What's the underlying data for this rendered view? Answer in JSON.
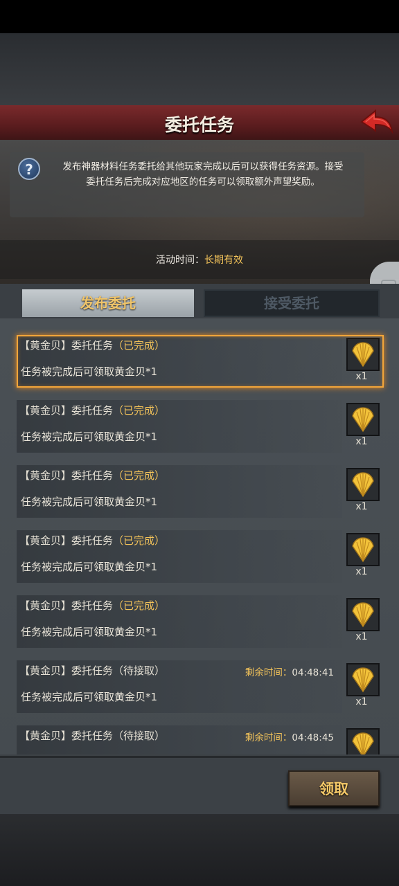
{
  "header": {
    "title": "委托任务"
  },
  "info": {
    "line1": "发布神器材料任务委托给其他玩家完成以后可以获得任务资源。接受",
    "line2": "委托任务后完成对应地区的任务可以领取额外声望奖励。",
    "activity_label": "活动时间：",
    "activity_value": "长期有效"
  },
  "tabs": [
    {
      "label": "发布委托",
      "active": true
    },
    {
      "label": "接受委托",
      "active": false
    }
  ],
  "tasks": [
    {
      "prefix": "【黄金贝】委托任务",
      "status": "（已完成）",
      "desc": "任务被完成后可领取黄金贝*1",
      "reward_icon": "golden-shell-icon",
      "count": "x1",
      "timer_label": "",
      "timer_value": ""
    },
    {
      "prefix": "【黄金贝】委托任务",
      "status": "（已完成）",
      "desc": "任务被完成后可领取黄金贝*1",
      "reward_icon": "golden-shell-icon",
      "count": "x1",
      "timer_label": "",
      "timer_value": ""
    },
    {
      "prefix": "【黄金贝】委托任务",
      "status": "（已完成）",
      "desc": "任务被完成后可领取黄金贝*1",
      "reward_icon": "golden-shell-icon",
      "count": "x1",
      "timer_label": "",
      "timer_value": ""
    },
    {
      "prefix": "【黄金贝】委托任务",
      "status": "（已完成）",
      "desc": "任务被完成后可领取黄金贝*1",
      "reward_icon": "golden-shell-icon",
      "count": "x1",
      "timer_label": "",
      "timer_value": ""
    },
    {
      "prefix": "【黄金贝】委托任务",
      "status": "（已完成）",
      "desc": "任务被完成后可领取黄金贝*1",
      "reward_icon": "golden-shell-icon",
      "count": "x1",
      "timer_label": "",
      "timer_value": ""
    },
    {
      "prefix": "【黄金贝】委托任务",
      "status": "（待接取）",
      "desc": "任务被完成后可领取黄金贝*1",
      "reward_icon": "golden-shell-icon",
      "count": "x1",
      "timer_label": "剩余时间：",
      "timer_value": "04:48:41"
    },
    {
      "prefix": "【黄金贝】委托任务",
      "status": "（待接取）",
      "desc": "",
      "reward_icon": "golden-shell-icon",
      "count": "",
      "timer_label": "剩余时间：",
      "timer_value": "04:48:45"
    }
  ],
  "footer": {
    "claim_label": "领取"
  },
  "colors": {
    "accent_gold": "#f3c35a",
    "header_red": "#6e2426",
    "selected_border": "#f3a63a"
  }
}
